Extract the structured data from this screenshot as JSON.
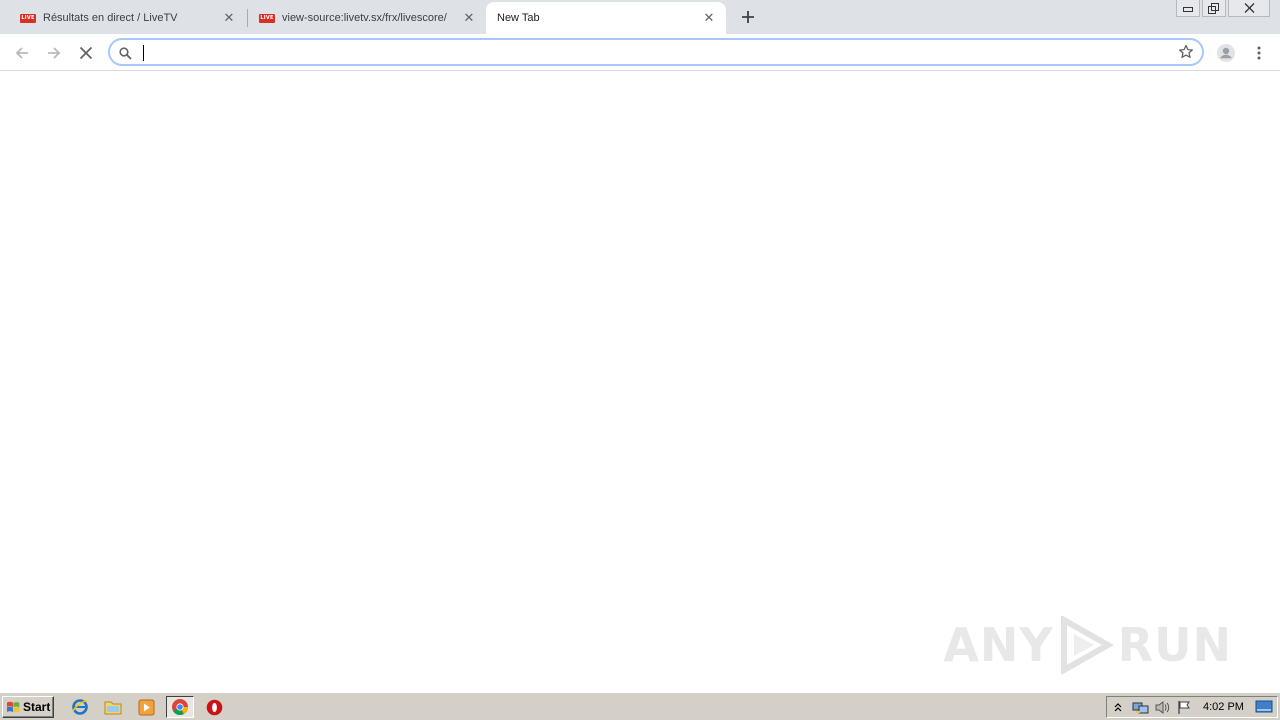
{
  "tabs": [
    {
      "title": "Résultats en direct / LiveTV",
      "favicon": "livetv-icon",
      "active": false
    },
    {
      "title": "view-source:livetv.sx/frx/livescore/",
      "favicon": "livetv-icon",
      "active": false
    },
    {
      "title": "New Tab",
      "favicon": "",
      "active": true
    }
  ],
  "favicon_text": "LIVE",
  "omnibox": {
    "value": "",
    "placeholder": ""
  },
  "watermark": {
    "left": "ANY",
    "right": "RUN"
  },
  "taskbar": {
    "start_label": "Start",
    "pinned": [
      "internet-explorer-icon",
      "file-explorer-icon",
      "media-player-icon",
      "chrome-icon",
      "opera-icon"
    ],
    "clock": "4:02 PM"
  },
  "colors": {
    "tabstrip": "#dee1e6",
    "omnibox_border": "#a8c7fa",
    "taskbar": "#d4d0c8",
    "favicon_red": "#d93025"
  }
}
